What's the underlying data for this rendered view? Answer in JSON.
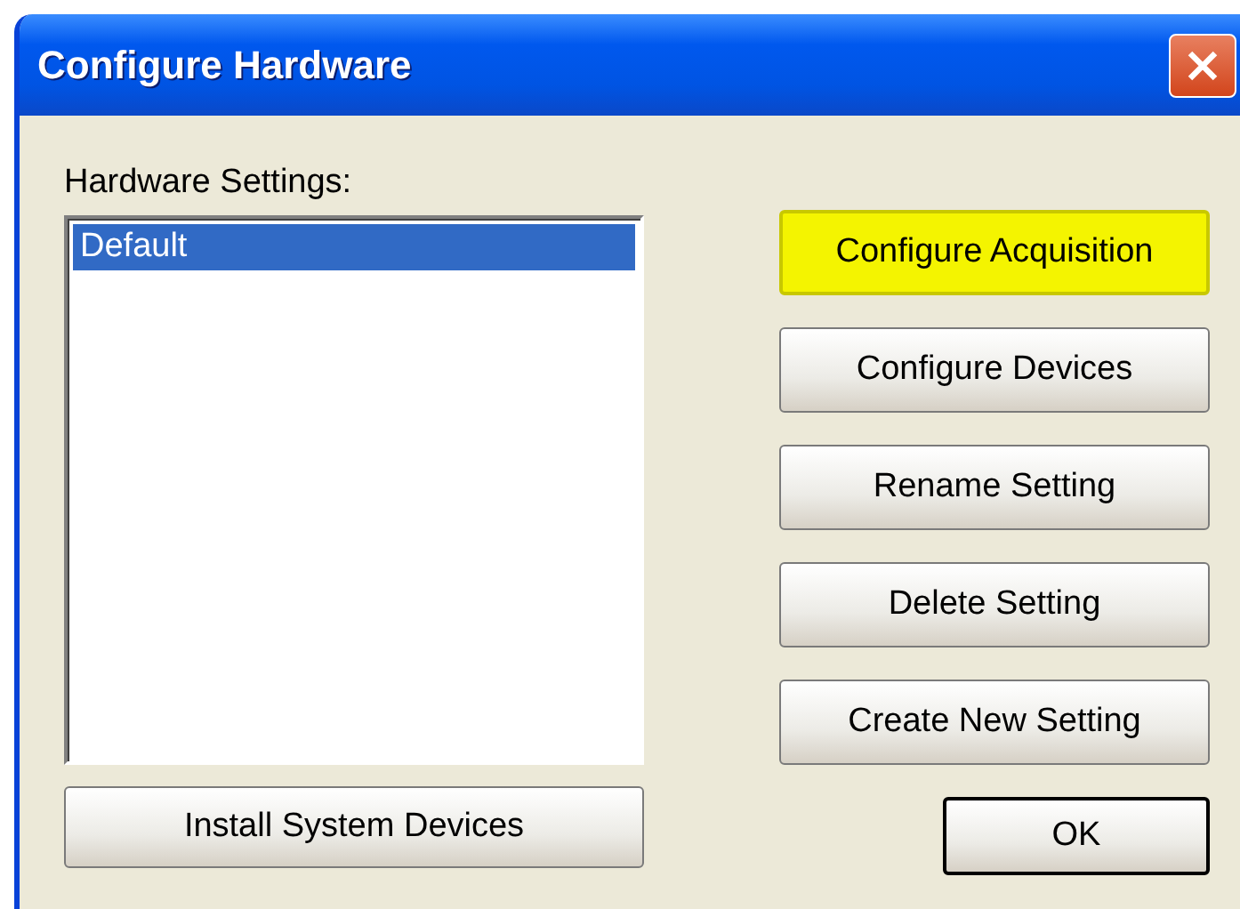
{
  "window": {
    "title": "Configure Hardware"
  },
  "hardware_settings": {
    "label": "Hardware Settings:",
    "items": [
      {
        "label": "Default",
        "selected": true
      }
    ]
  },
  "install_button": {
    "label": "Install System Devices"
  },
  "buttons": [
    {
      "label": "Configure Acquisition",
      "highlighted": true
    },
    {
      "label": "Configure Devices",
      "highlighted": false
    },
    {
      "label": "Rename Setting",
      "highlighted": false
    },
    {
      "label": "Delete Setting",
      "highlighted": false
    },
    {
      "label": "Create New Setting",
      "highlighted": false
    }
  ],
  "ok_button": {
    "label": "OK",
    "default": true
  }
}
